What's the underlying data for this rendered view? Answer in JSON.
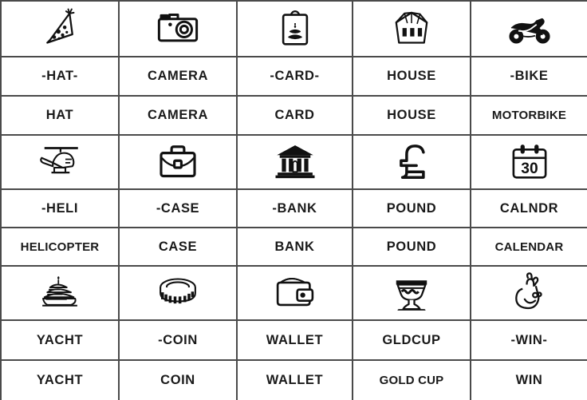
{
  "page": {
    "title": "Symbol Reference Grid",
    "border_color": "#4a4a4a",
    "text_color": "#1a1a1a",
    "background": "#ffffff",
    "columns": 5,
    "blocks": 3
  },
  "blocks": [
    {
      "entries": [
        {
          "icon": "party-hat-icon",
          "short": "-HAT-",
          "full": "HAT"
        },
        {
          "icon": "camera-icon",
          "short": "CAMERA",
          "full": "CAMERA"
        },
        {
          "icon": "greeting-card-icon",
          "short": "-CARD-",
          "full": "CARD"
        },
        {
          "icon": "house-icon",
          "short": "HOUSE",
          "full": "HOUSE"
        },
        {
          "icon": "motorbike-icon",
          "short": "-BIKE",
          "full": "MOTORBIKE"
        }
      ]
    },
    {
      "entries": [
        {
          "icon": "helicopter-icon",
          "short": "-HELI",
          "full": "HELICOPTER"
        },
        {
          "icon": "briefcase-icon",
          "short": "-CASE",
          "full": "CASE"
        },
        {
          "icon": "bank-icon",
          "short": "-BANK",
          "full": "BANK"
        },
        {
          "icon": "pound-sign-icon",
          "short": "POUND",
          "full": "POUND"
        },
        {
          "icon": "calendar-icon",
          "short": "CALNDR",
          "full": "CALENDAR"
        }
      ]
    },
    {
      "entries": [
        {
          "icon": "yacht-icon",
          "short": "YACHT",
          "full": "YACHT"
        },
        {
          "icon": "coin-stack-icon",
          "short": "-COIN",
          "full": "COIN"
        },
        {
          "icon": "wallet-icon",
          "short": "WALLET",
          "full": "WALLET"
        },
        {
          "icon": "gold-cup-icon",
          "short": "GLDCUP",
          "full": "GOLD CUP"
        },
        {
          "icon": "crossed-fingers-icon",
          "short": "-WIN-",
          "full": "WIN"
        }
      ]
    }
  ],
  "calendar": {
    "day_number": "30"
  }
}
